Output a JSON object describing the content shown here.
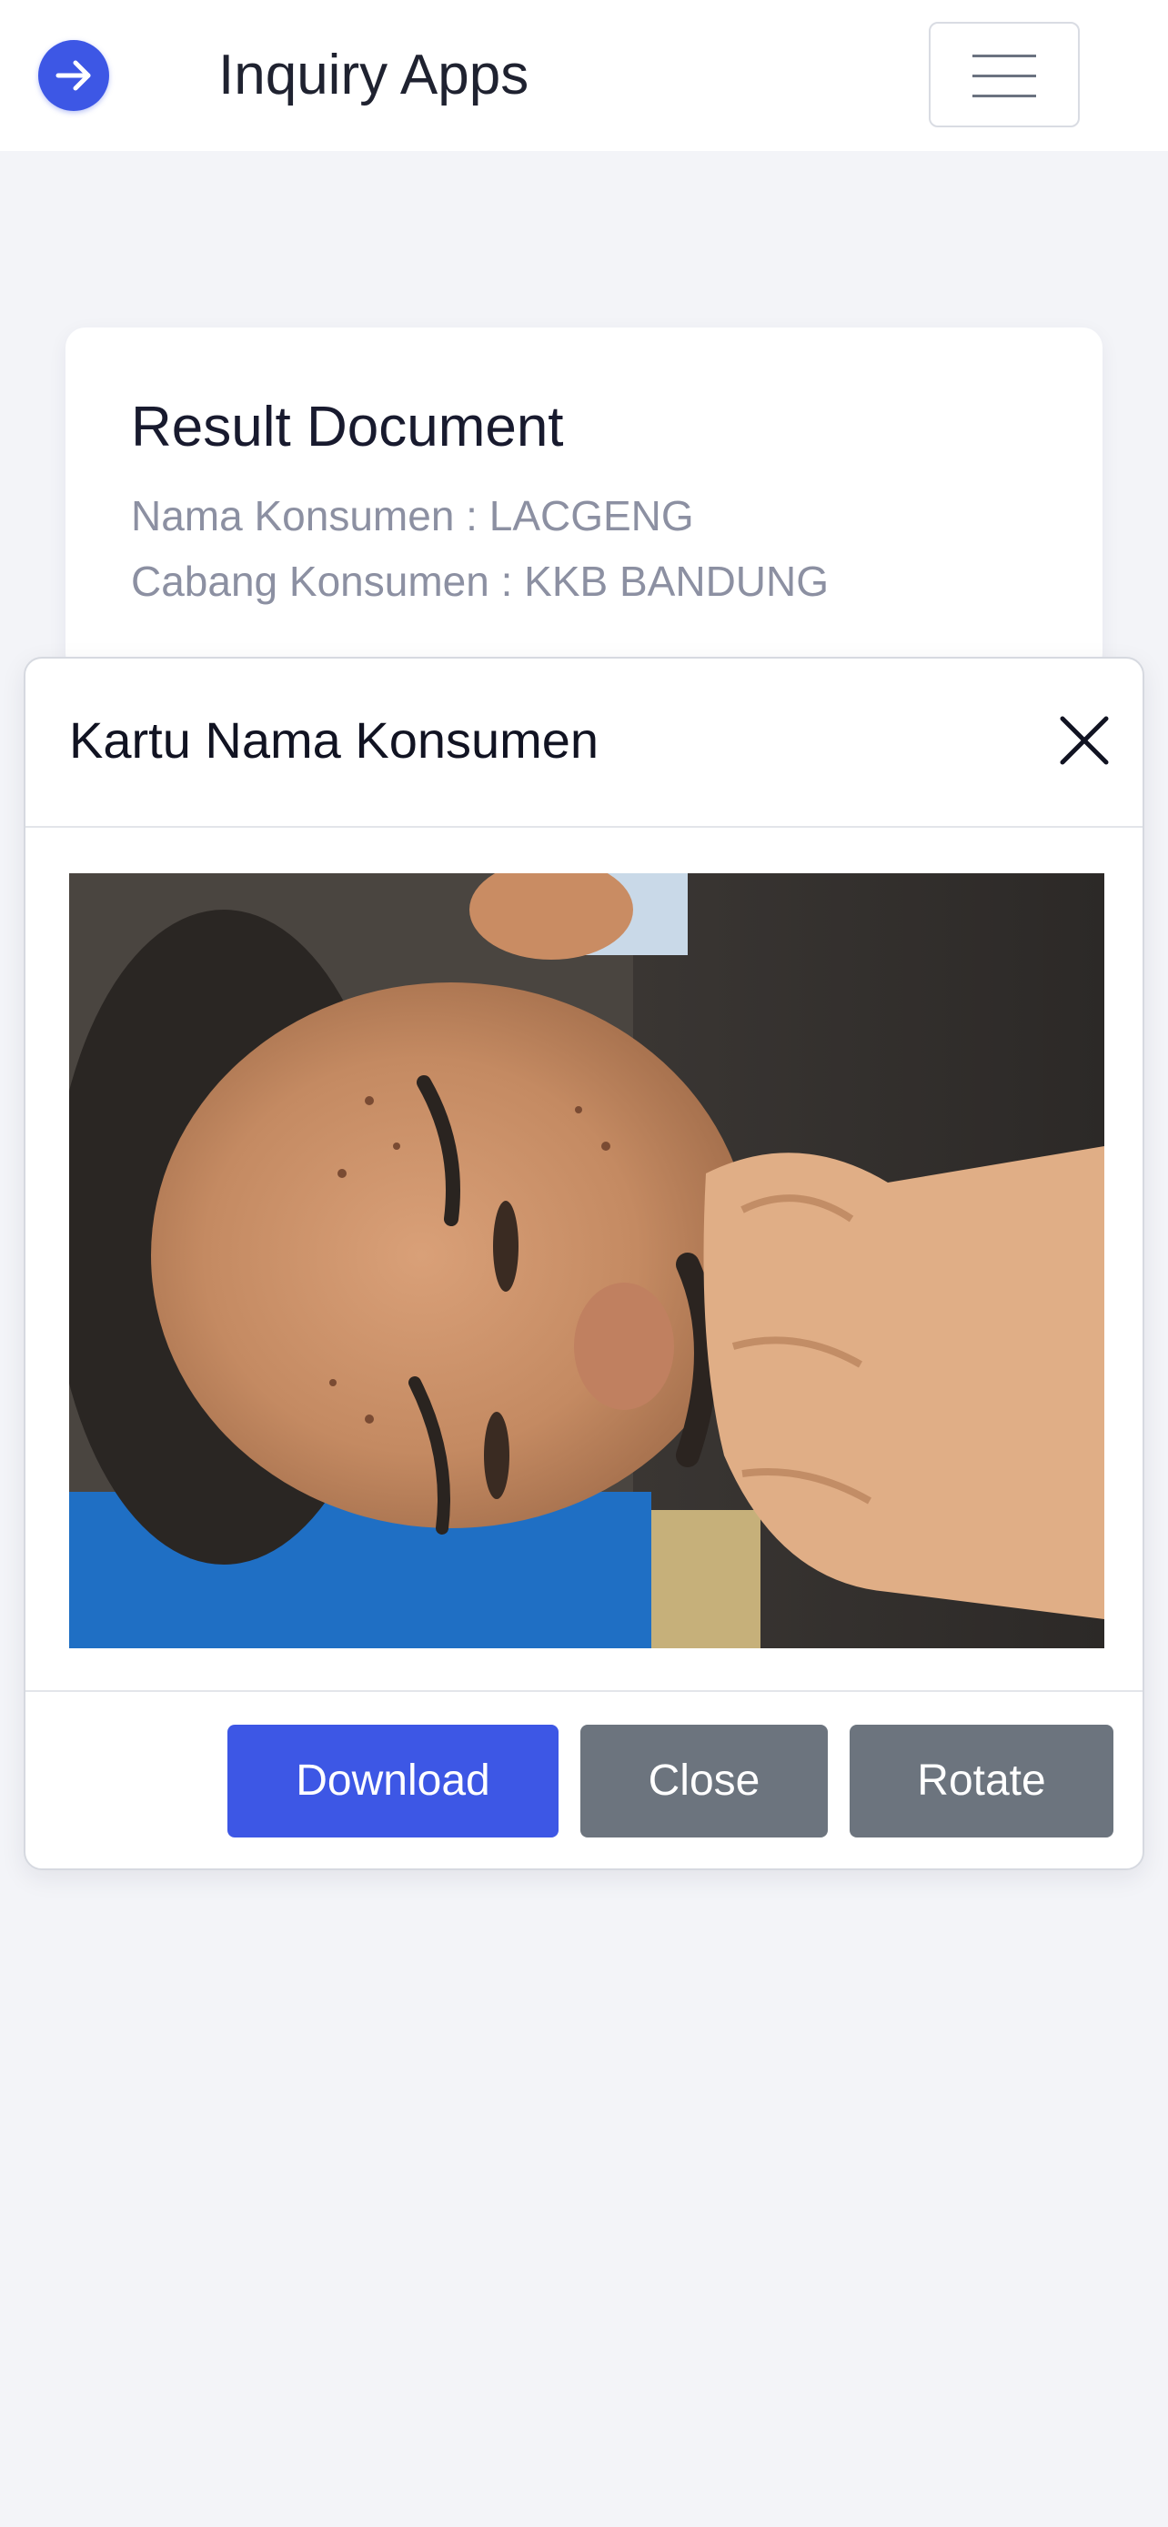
{
  "navbar": {
    "brand_icon": "arrow-right-circle-icon",
    "title": "Inquiry Apps",
    "menu_icon": "hamburger-menu-icon"
  },
  "result": {
    "title": "Result Document",
    "customer_name": "Nama Konsumen : LACGENG",
    "customer_branch": "Cabang Konsumen : KKB BANDUNG"
  },
  "modal": {
    "title": "Kartu Nama Konsumen",
    "close_icon": "close-x-icon",
    "image_subject": "customer-photo",
    "buttons": {
      "download": "Download",
      "close": "Close",
      "rotate": "Rotate"
    }
  },
  "colors": {
    "primary": "#3d57e5",
    "secondary": "#6c747e",
    "background": "#f3f4f8",
    "muted_text": "#8c90a2"
  }
}
